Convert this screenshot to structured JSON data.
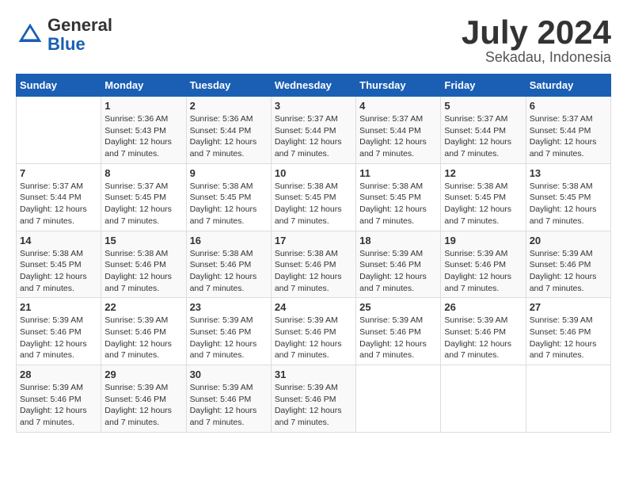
{
  "header": {
    "logo": {
      "general": "General",
      "blue": "Blue"
    },
    "month": "July 2024",
    "location": "Sekadau, Indonesia"
  },
  "days_of_week": [
    "Sunday",
    "Monday",
    "Tuesday",
    "Wednesday",
    "Thursday",
    "Friday",
    "Saturday"
  ],
  "weeks": [
    [
      {
        "day": "",
        "info": ""
      },
      {
        "day": "1",
        "info": "Sunrise: 5:36 AM\nSunset: 5:43 PM\nDaylight: 12 hours\nand 7 minutes."
      },
      {
        "day": "2",
        "info": "Sunrise: 5:36 AM\nSunset: 5:44 PM\nDaylight: 12 hours\nand 7 minutes."
      },
      {
        "day": "3",
        "info": "Sunrise: 5:37 AM\nSunset: 5:44 PM\nDaylight: 12 hours\nand 7 minutes."
      },
      {
        "day": "4",
        "info": "Sunrise: 5:37 AM\nSunset: 5:44 PM\nDaylight: 12 hours\nand 7 minutes."
      },
      {
        "day": "5",
        "info": "Sunrise: 5:37 AM\nSunset: 5:44 PM\nDaylight: 12 hours\nand 7 minutes."
      },
      {
        "day": "6",
        "info": "Sunrise: 5:37 AM\nSunset: 5:44 PM\nDaylight: 12 hours\nand 7 minutes."
      }
    ],
    [
      {
        "day": "7",
        "info": "Sunrise: 5:37 AM\nSunset: 5:44 PM\nDaylight: 12 hours\nand 7 minutes."
      },
      {
        "day": "8",
        "info": "Sunrise: 5:37 AM\nSunset: 5:45 PM\nDaylight: 12 hours\nand 7 minutes."
      },
      {
        "day": "9",
        "info": "Sunrise: 5:38 AM\nSunset: 5:45 PM\nDaylight: 12 hours\nand 7 minutes."
      },
      {
        "day": "10",
        "info": "Sunrise: 5:38 AM\nSunset: 5:45 PM\nDaylight: 12 hours\nand 7 minutes."
      },
      {
        "day": "11",
        "info": "Sunrise: 5:38 AM\nSunset: 5:45 PM\nDaylight: 12 hours\nand 7 minutes."
      },
      {
        "day": "12",
        "info": "Sunrise: 5:38 AM\nSunset: 5:45 PM\nDaylight: 12 hours\nand 7 minutes."
      },
      {
        "day": "13",
        "info": "Sunrise: 5:38 AM\nSunset: 5:45 PM\nDaylight: 12 hours\nand 7 minutes."
      }
    ],
    [
      {
        "day": "14",
        "info": "Sunrise: 5:38 AM\nSunset: 5:45 PM\nDaylight: 12 hours\nand 7 minutes."
      },
      {
        "day": "15",
        "info": "Sunrise: 5:38 AM\nSunset: 5:46 PM\nDaylight: 12 hours\nand 7 minutes."
      },
      {
        "day": "16",
        "info": "Sunrise: 5:38 AM\nSunset: 5:46 PM\nDaylight: 12 hours\nand 7 minutes."
      },
      {
        "day": "17",
        "info": "Sunrise: 5:38 AM\nSunset: 5:46 PM\nDaylight: 12 hours\nand 7 minutes."
      },
      {
        "day": "18",
        "info": "Sunrise: 5:39 AM\nSunset: 5:46 PM\nDaylight: 12 hours\nand 7 minutes."
      },
      {
        "day": "19",
        "info": "Sunrise: 5:39 AM\nSunset: 5:46 PM\nDaylight: 12 hours\nand 7 minutes."
      },
      {
        "day": "20",
        "info": "Sunrise: 5:39 AM\nSunset: 5:46 PM\nDaylight: 12 hours\nand 7 minutes."
      }
    ],
    [
      {
        "day": "21",
        "info": "Sunrise: 5:39 AM\nSunset: 5:46 PM\nDaylight: 12 hours\nand 7 minutes."
      },
      {
        "day": "22",
        "info": "Sunrise: 5:39 AM\nSunset: 5:46 PM\nDaylight: 12 hours\nand 7 minutes."
      },
      {
        "day": "23",
        "info": "Sunrise: 5:39 AM\nSunset: 5:46 PM\nDaylight: 12 hours\nand 7 minutes."
      },
      {
        "day": "24",
        "info": "Sunrise: 5:39 AM\nSunset: 5:46 PM\nDaylight: 12 hours\nand 7 minutes."
      },
      {
        "day": "25",
        "info": "Sunrise: 5:39 AM\nSunset: 5:46 PM\nDaylight: 12 hours\nand 7 minutes."
      },
      {
        "day": "26",
        "info": "Sunrise: 5:39 AM\nSunset: 5:46 PM\nDaylight: 12 hours\nand 7 minutes."
      },
      {
        "day": "27",
        "info": "Sunrise: 5:39 AM\nSunset: 5:46 PM\nDaylight: 12 hours\nand 7 minutes."
      }
    ],
    [
      {
        "day": "28",
        "info": "Sunrise: 5:39 AM\nSunset: 5:46 PM\nDaylight: 12 hours\nand 7 minutes."
      },
      {
        "day": "29",
        "info": "Sunrise: 5:39 AM\nSunset: 5:46 PM\nDaylight: 12 hours\nand 7 minutes."
      },
      {
        "day": "30",
        "info": "Sunrise: 5:39 AM\nSunset: 5:46 PM\nDaylight: 12 hours\nand 7 minutes."
      },
      {
        "day": "31",
        "info": "Sunrise: 5:39 AM\nSunset: 5:46 PM\nDaylight: 12 hours\nand 7 minutes."
      },
      {
        "day": "",
        "info": ""
      },
      {
        "day": "",
        "info": ""
      },
      {
        "day": "",
        "info": ""
      }
    ]
  ]
}
